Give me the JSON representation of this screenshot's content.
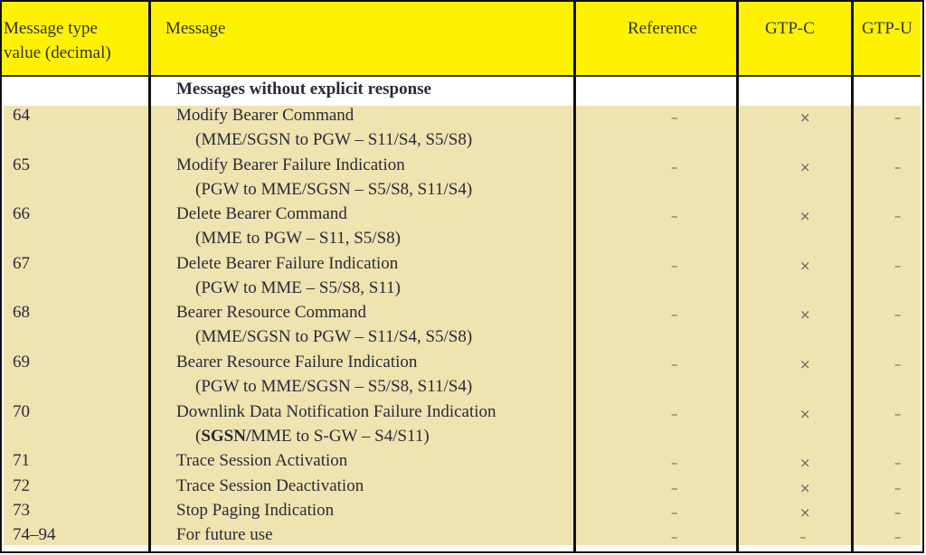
{
  "table": {
    "headers": {
      "type_value": "Message type value (decimal)",
      "type_value_line1": "Message type",
      "type_value_line2": "value (decimal)",
      "message": "Message",
      "reference": "Reference",
      "gtp_c": "GTP-C",
      "gtp_u": "GTP-U"
    },
    "section_title": "Messages without explicit response",
    "rows": [
      {
        "value": "64",
        "message": "Modify Bearer Command",
        "detail": "(MME/SGSN to PGW – S11/S4, S5/S8)",
        "reference": "–",
        "gtp_c": "×",
        "gtp_u": "–"
      },
      {
        "value": "65",
        "message": "Modify Bearer Failure Indication",
        "detail": "(PGW to MME/SGSN – S5/S8, S11/S4)",
        "reference": "–",
        "gtp_c": "×",
        "gtp_u": "–"
      },
      {
        "value": "66",
        "message": "Delete Bearer Command",
        "detail": "(MME to PGW – S11, S5/S8)",
        "reference": "–",
        "gtp_c": "×",
        "gtp_u": "–"
      },
      {
        "value": "67",
        "message": "Delete Bearer Failure Indication",
        "detail": "(PGW to MME – S5/S8, S11)",
        "reference": "–",
        "gtp_c": "×",
        "gtp_u": "–"
      },
      {
        "value": "68",
        "message": "Bearer Resource Command",
        "detail": "(MME/SGSN to PGW – S11/S4, S5/S8)",
        "reference": "–",
        "gtp_c": "×",
        "gtp_u": "–"
      },
      {
        "value": "69",
        "message": "Bearer Resource Failure Indication",
        "detail": "(PGW to MME/SGSN – S5/S8, S11/S4)",
        "reference": "–",
        "gtp_c": "×",
        "gtp_u": "–"
      },
      {
        "value": "70",
        "message": "Downlink Data Notification Failure Indication",
        "detail_bold": "SGSN/",
        "detail_pre": "(",
        "detail_post": "MME to S-GW – S4/S11)",
        "reference": "–",
        "gtp_c": "×",
        "gtp_u": "–"
      },
      {
        "value": "71",
        "message": "Trace Session Activation",
        "reference": "–",
        "gtp_c": "×",
        "gtp_u": "–"
      },
      {
        "value": "72",
        "message": "Trace Session Deactivation",
        "reference": "–",
        "gtp_c": "×",
        "gtp_u": "–"
      },
      {
        "value": "73",
        "message": "Stop Paging Indication",
        "reference": "–",
        "gtp_c": "×",
        "gtp_u": "–"
      },
      {
        "value": "74–94",
        "message": "For future use",
        "reference": "–",
        "gtp_c": "–",
        "gtp_u": "–"
      }
    ]
  }
}
